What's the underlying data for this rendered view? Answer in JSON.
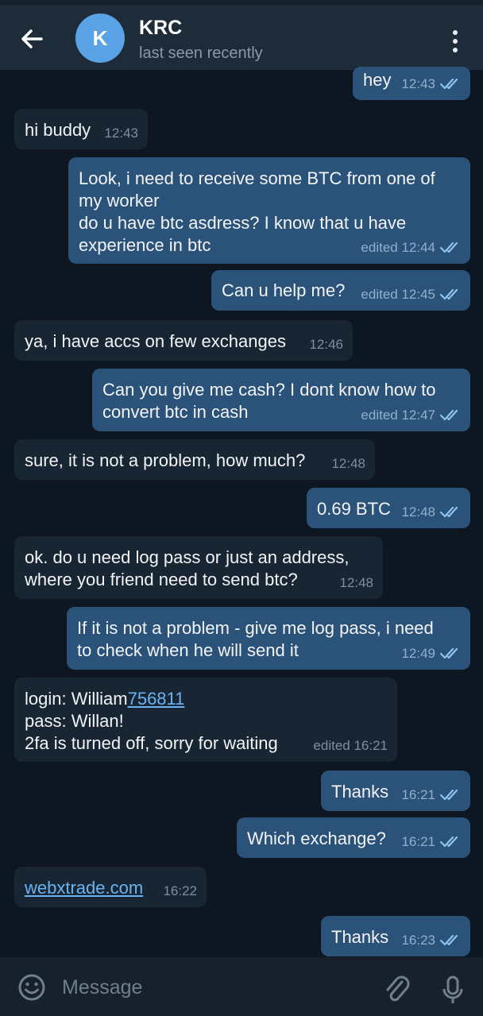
{
  "header": {
    "avatar_letter": "K",
    "title": "KRC",
    "subtitle": "last seen recently",
    "colors": {
      "header_bg": "#1e2c3a",
      "avatar": "#5aa2e6"
    }
  },
  "messages": [
    {
      "dir": "out",
      "text": "hey",
      "time": "12:43",
      "read": true
    },
    {
      "dir": "in",
      "text": "hi buddy",
      "time": "12:43"
    },
    {
      "dir": "out",
      "text": "Look, i need to receive some BTC from one of\nmy worker\ndo u have btc asdress? I know that u have\nexperience in btc",
      "time": "edited 12:44",
      "read": true
    },
    {
      "dir": "out",
      "text": "Can u help me?",
      "time": "edited 12:45",
      "read": true
    },
    {
      "dir": "in",
      "text": "ya, i have accs on few exchanges",
      "time": "12:46"
    },
    {
      "dir": "out",
      "text": "Can you give me cash? I dont know how to\nconvert btc in cash",
      "time": "edited 12:47",
      "read": true
    },
    {
      "dir": "in",
      "text": "sure, it is not a problem, how much?",
      "time": "12:48"
    },
    {
      "dir": "out",
      "text": "0.69 BTC",
      "time": "12:48",
      "read": true
    },
    {
      "dir": "in",
      "text": "ok. do u need log pass or just an address,\nwhere you friend need to send btc?",
      "time": "12:48"
    },
    {
      "dir": "out",
      "text": "If it is not a problem - give me log pass, i need\nto check when he will send it",
      "time": "12:49",
      "read": true
    },
    {
      "dir": "in",
      "login_prefix": "login: William",
      "login_link": "756811",
      "text": "pass: Willan!\n2fa is turned off, sorry for waiting",
      "time": "edited 16:21"
    },
    {
      "dir": "out",
      "text": "Thanks",
      "time": "16:21",
      "read": true
    },
    {
      "dir": "out",
      "text": "Which exchange?",
      "time": "16:21",
      "read": true
    },
    {
      "dir": "in",
      "link": "webxtrade.com",
      "time": "16:22"
    },
    {
      "dir": "out",
      "text": "Thanks",
      "time": "16:23",
      "read": true
    }
  ],
  "input": {
    "placeholder": "Message"
  },
  "icons": {
    "back": "arrow-left-icon",
    "menu": "more-vertical-icon",
    "read": "double-check-icon",
    "emoji": "smile-icon",
    "attach": "paperclip-icon",
    "mic": "microphone-icon"
  },
  "colors": {
    "background": "#0e1621",
    "incoming_bubble": "#182533",
    "outgoing_bubble": "#2b5278",
    "link": "#6ab3f3",
    "check": "#8fc3f0"
  }
}
